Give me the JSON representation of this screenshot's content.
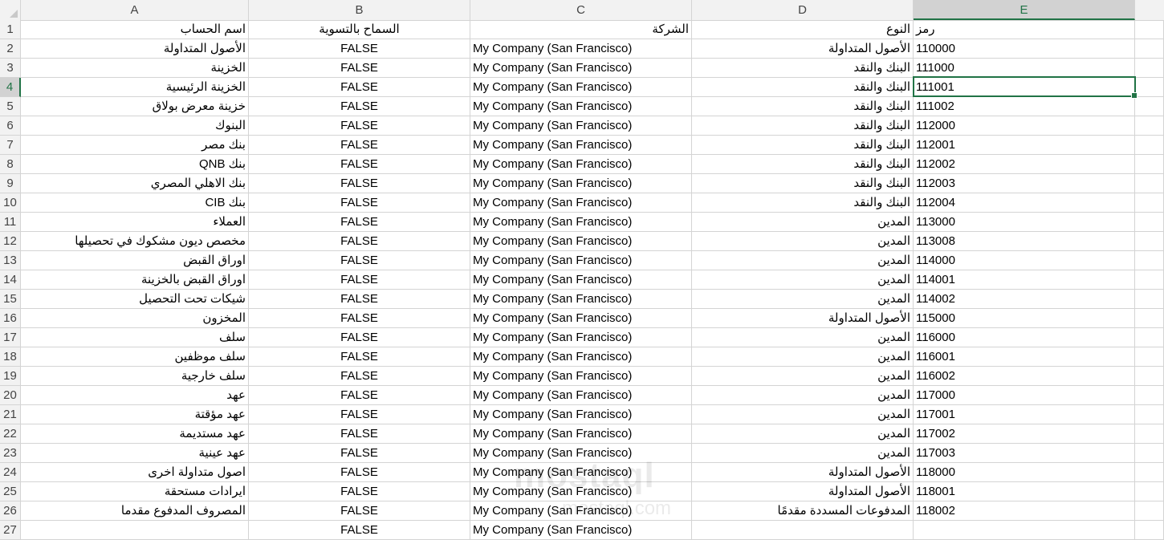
{
  "columns": [
    "A",
    "B",
    "C",
    "D",
    "E"
  ],
  "header_row": {
    "row_number": "1",
    "a": "اسم الحساب",
    "b": "السماح بالتسوية",
    "c": "الشركة",
    "d": "النوع",
    "e": "رمز"
  },
  "rows": [
    {
      "n": "2",
      "a": "الأصول المتداولة",
      "b": "FALSE",
      "c": "My Company (San Francisco)",
      "d": "الأصول المتداولة",
      "e": "110000"
    },
    {
      "n": "3",
      "a": "الخزينة",
      "b": "FALSE",
      "c": "My Company (San Francisco)",
      "d": "البنك والنقد",
      "e": "111000"
    },
    {
      "n": "4",
      "a": "الخزينة الرئيسية",
      "b": "FALSE",
      "c": "My Company (San Francisco)",
      "d": "البنك والنقد",
      "e": "111001"
    },
    {
      "n": "5",
      "a": "خزينة معرض بولاق",
      "b": "FALSE",
      "c": "My Company (San Francisco)",
      "d": "البنك والنقد",
      "e": "111002"
    },
    {
      "n": "6",
      "a": "البنوك",
      "b": "FALSE",
      "c": "My Company (San Francisco)",
      "d": "البنك والنقد",
      "e": "112000"
    },
    {
      "n": "7",
      "a": "بنك مصر",
      "b": "FALSE",
      "c": "My Company (San Francisco)",
      "d": "البنك والنقد",
      "e": "112001"
    },
    {
      "n": "8",
      "a": "بنك QNB",
      "b": "FALSE",
      "c": "My Company (San Francisco)",
      "d": "البنك والنقد",
      "e": "112002"
    },
    {
      "n": "9",
      "a": "بنك الاهلي المصري",
      "b": "FALSE",
      "c": "My Company (San Francisco)",
      "d": "البنك والنقد",
      "e": "112003"
    },
    {
      "n": "10",
      "a": "بنك CIB",
      "b": "FALSE",
      "c": "My Company (San Francisco)",
      "d": "البنك والنقد",
      "e": "112004"
    },
    {
      "n": "11",
      "a": "العملاء",
      "b": "FALSE",
      "c": "My Company (San Francisco)",
      "d": "المدين",
      "e": "113000"
    },
    {
      "n": "12",
      "a": "مخصص ديون مشكوك في تحصيلها",
      "b": "FALSE",
      "c": "My Company (San Francisco)",
      "d": "المدين",
      "e": "113008"
    },
    {
      "n": "13",
      "a": "اوراق القبض",
      "b": "FALSE",
      "c": "My Company (San Francisco)",
      "d": "المدين",
      "e": "114000"
    },
    {
      "n": "14",
      "a": "اوراق القبض بالخزينة",
      "b": "FALSE",
      "c": "My Company (San Francisco)",
      "d": "المدين",
      "e": "114001"
    },
    {
      "n": "15",
      "a": "شيكات تحت التحصيل",
      "b": "FALSE",
      "c": "My Company (San Francisco)",
      "d": "المدين",
      "e": "114002"
    },
    {
      "n": "16",
      "a": "المخزون",
      "b": "FALSE",
      "c": "My Company (San Francisco)",
      "d": "الأصول المتداولة",
      "e": "115000"
    },
    {
      "n": "17",
      "a": "سلف",
      "b": "FALSE",
      "c": "My Company (San Francisco)",
      "d": "المدين",
      "e": "116000"
    },
    {
      "n": "18",
      "a": "سلف موظفين",
      "b": "FALSE",
      "c": "My Company (San Francisco)",
      "d": "المدين",
      "e": "116001"
    },
    {
      "n": "19",
      "a": "سلف خارجية",
      "b": "FALSE",
      "c": "My Company (San Francisco)",
      "d": "المدين",
      "e": "116002"
    },
    {
      "n": "20",
      "a": "عهد",
      "b": "FALSE",
      "c": "My Company (San Francisco)",
      "d": "المدين",
      "e": "117000"
    },
    {
      "n": "21",
      "a": "عهد مؤقتة",
      "b": "FALSE",
      "c": "My Company (San Francisco)",
      "d": "المدين",
      "e": "117001"
    },
    {
      "n": "22",
      "a": "عهد مستديمة",
      "b": "FALSE",
      "c": "My Company (San Francisco)",
      "d": "المدين",
      "e": "117002"
    },
    {
      "n": "23",
      "a": "عهد عينية",
      "b": "FALSE",
      "c": "My Company (San Francisco)",
      "d": "المدين",
      "e": "117003"
    },
    {
      "n": "24",
      "a": "اصول متداولة اخرى",
      "b": "FALSE",
      "c": "My Company (San Francisco)",
      "d": "الأصول المتداولة",
      "e": "118000"
    },
    {
      "n": "25",
      "a": "ايرادات مستحقة",
      "b": "FALSE",
      "c": "My Company (San Francisco)",
      "d": "الأصول المتداولة",
      "e": "118001"
    },
    {
      "n": "26",
      "a": "المصروف المدفوع مقدما",
      "b": "FALSE",
      "c": "My Company (San Francisco)",
      "d": "المدفوعات المسددة مقدمًا",
      "e": "118002"
    },
    {
      "n": "27",
      "a": "",
      "b": "FALSE",
      "c": "My Company (San Francisco)",
      "d": "",
      "e": ""
    }
  ],
  "watermark": {
    "logo": "mostaql",
    "url": "mostaql.com"
  },
  "colors": {
    "accent": "#217346",
    "grid": "#d4d4d4",
    "header_bg": "#f2f2f2"
  }
}
